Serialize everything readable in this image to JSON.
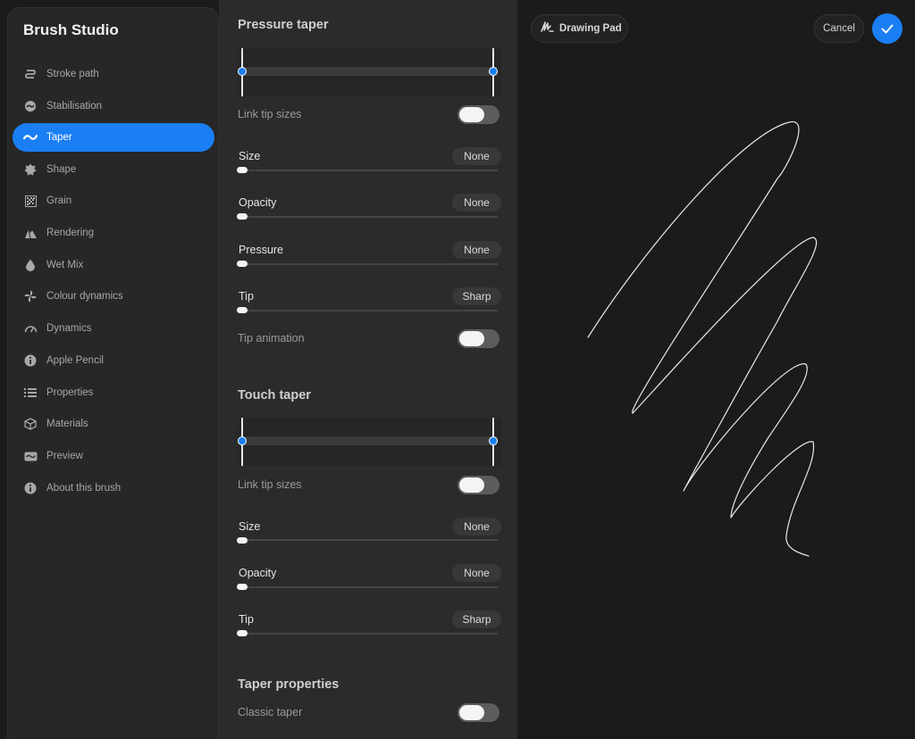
{
  "sidebar": {
    "title": "Brush Studio",
    "items": [
      {
        "label": "Stroke path",
        "icon": "stroke-path-icon"
      },
      {
        "label": "Stabilisation",
        "icon": "stabilisation-icon"
      },
      {
        "label": "Taper",
        "icon": "taper-icon",
        "active": true
      },
      {
        "label": "Shape",
        "icon": "shape-icon"
      },
      {
        "label": "Grain",
        "icon": "grain-icon"
      },
      {
        "label": "Rendering",
        "icon": "rendering-icon"
      },
      {
        "label": "Wet Mix",
        "icon": "wet-mix-icon"
      },
      {
        "label": "Colour dynamics",
        "icon": "colour-dynamics-icon"
      },
      {
        "label": "Dynamics",
        "icon": "dynamics-icon"
      },
      {
        "label": "Apple Pencil",
        "icon": "apple-pencil-icon"
      },
      {
        "label": "Properties",
        "icon": "properties-icon"
      },
      {
        "label": "Materials",
        "icon": "materials-icon"
      },
      {
        "label": "Preview",
        "icon": "preview-icon"
      },
      {
        "label": "About this brush",
        "icon": "info-icon"
      }
    ]
  },
  "pressure_taper": {
    "title": "Pressure taper",
    "link_tip_sizes": "Link tip sizes",
    "size": {
      "label": "Size",
      "value": "None"
    },
    "opacity": {
      "label": "Opacity",
      "value": "None"
    },
    "pressure": {
      "label": "Pressure",
      "value": "None"
    },
    "tip": {
      "label": "Tip",
      "value": "Sharp"
    },
    "tip_animation": "Tip animation"
  },
  "touch_taper": {
    "title": "Touch taper",
    "link_tip_sizes": "Link tip sizes",
    "size": {
      "label": "Size",
      "value": "None"
    },
    "opacity": {
      "label": "Opacity",
      "value": "None"
    },
    "tip": {
      "label": "Tip",
      "value": "Sharp"
    }
  },
  "taper_properties": {
    "title": "Taper properties",
    "classic_taper": "Classic taper"
  },
  "drawing_pad": {
    "label": "Drawing Pad",
    "cancel": "Cancel"
  },
  "colors": {
    "accent": "#1a7ff3"
  }
}
